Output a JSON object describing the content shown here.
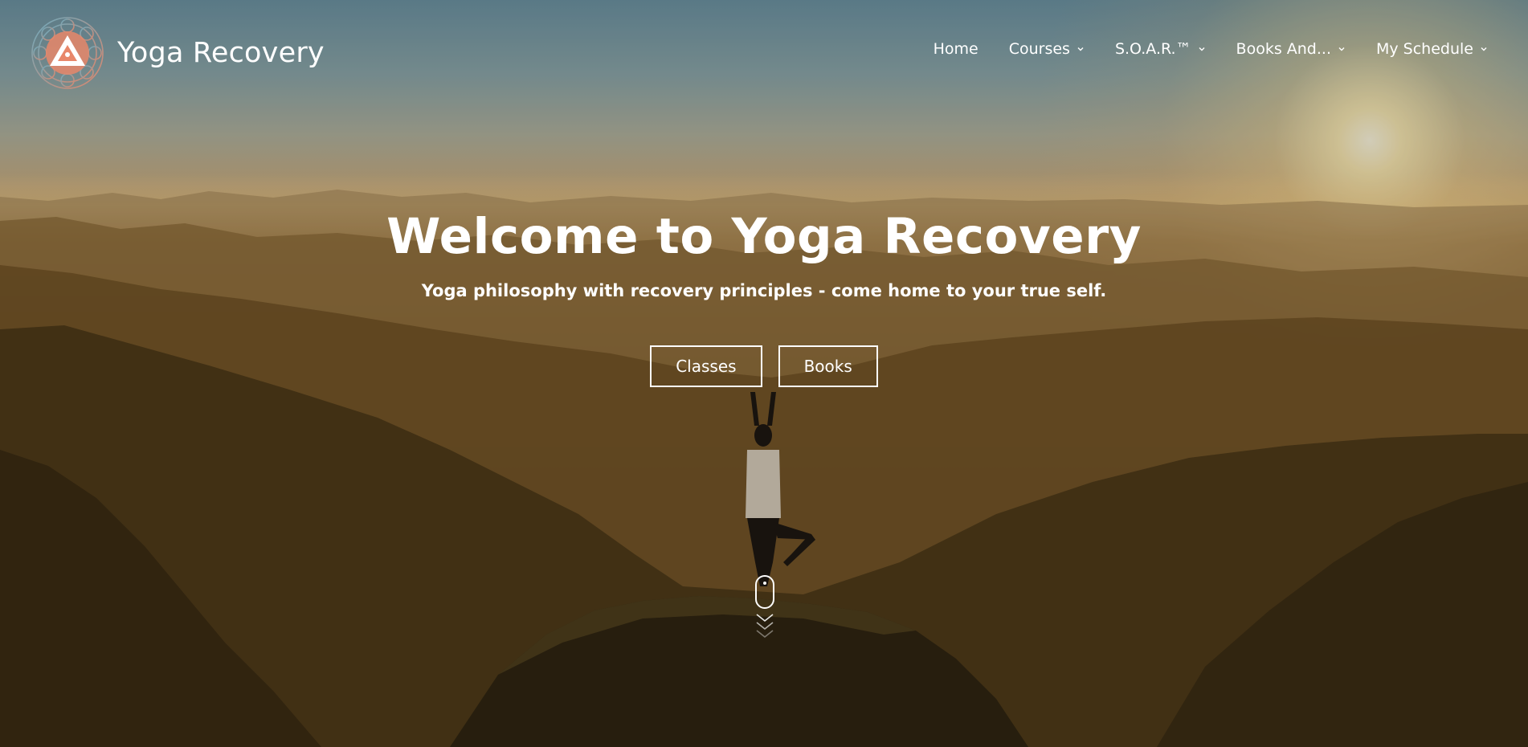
{
  "site": {
    "title": "Yoga Recovery",
    "logo_icon": "mandala-lotus-triangle-icon"
  },
  "nav": {
    "items": [
      {
        "label": "Home",
        "has_dropdown": false
      },
      {
        "label": "Courses",
        "has_dropdown": true
      },
      {
        "label": "S.O.A.R.™",
        "has_dropdown": true
      },
      {
        "label": "Books And...",
        "has_dropdown": true
      },
      {
        "label": "My Schedule",
        "has_dropdown": true
      }
    ]
  },
  "hero": {
    "title": "Welcome to Yoga Recovery",
    "subtitle": "Yoga philosophy with recovery principles - come home to your true self.",
    "buttons": [
      {
        "label": "Classes"
      },
      {
        "label": "Books"
      }
    ],
    "scroll_icon": "mouse-scroll-icon",
    "background": "mountain-sunset-yoga-tree-pose-photo"
  },
  "colors": {
    "text": "#ffffff",
    "logo_accent": "#e8876a",
    "logo_secondary": "#7ab3c0"
  }
}
